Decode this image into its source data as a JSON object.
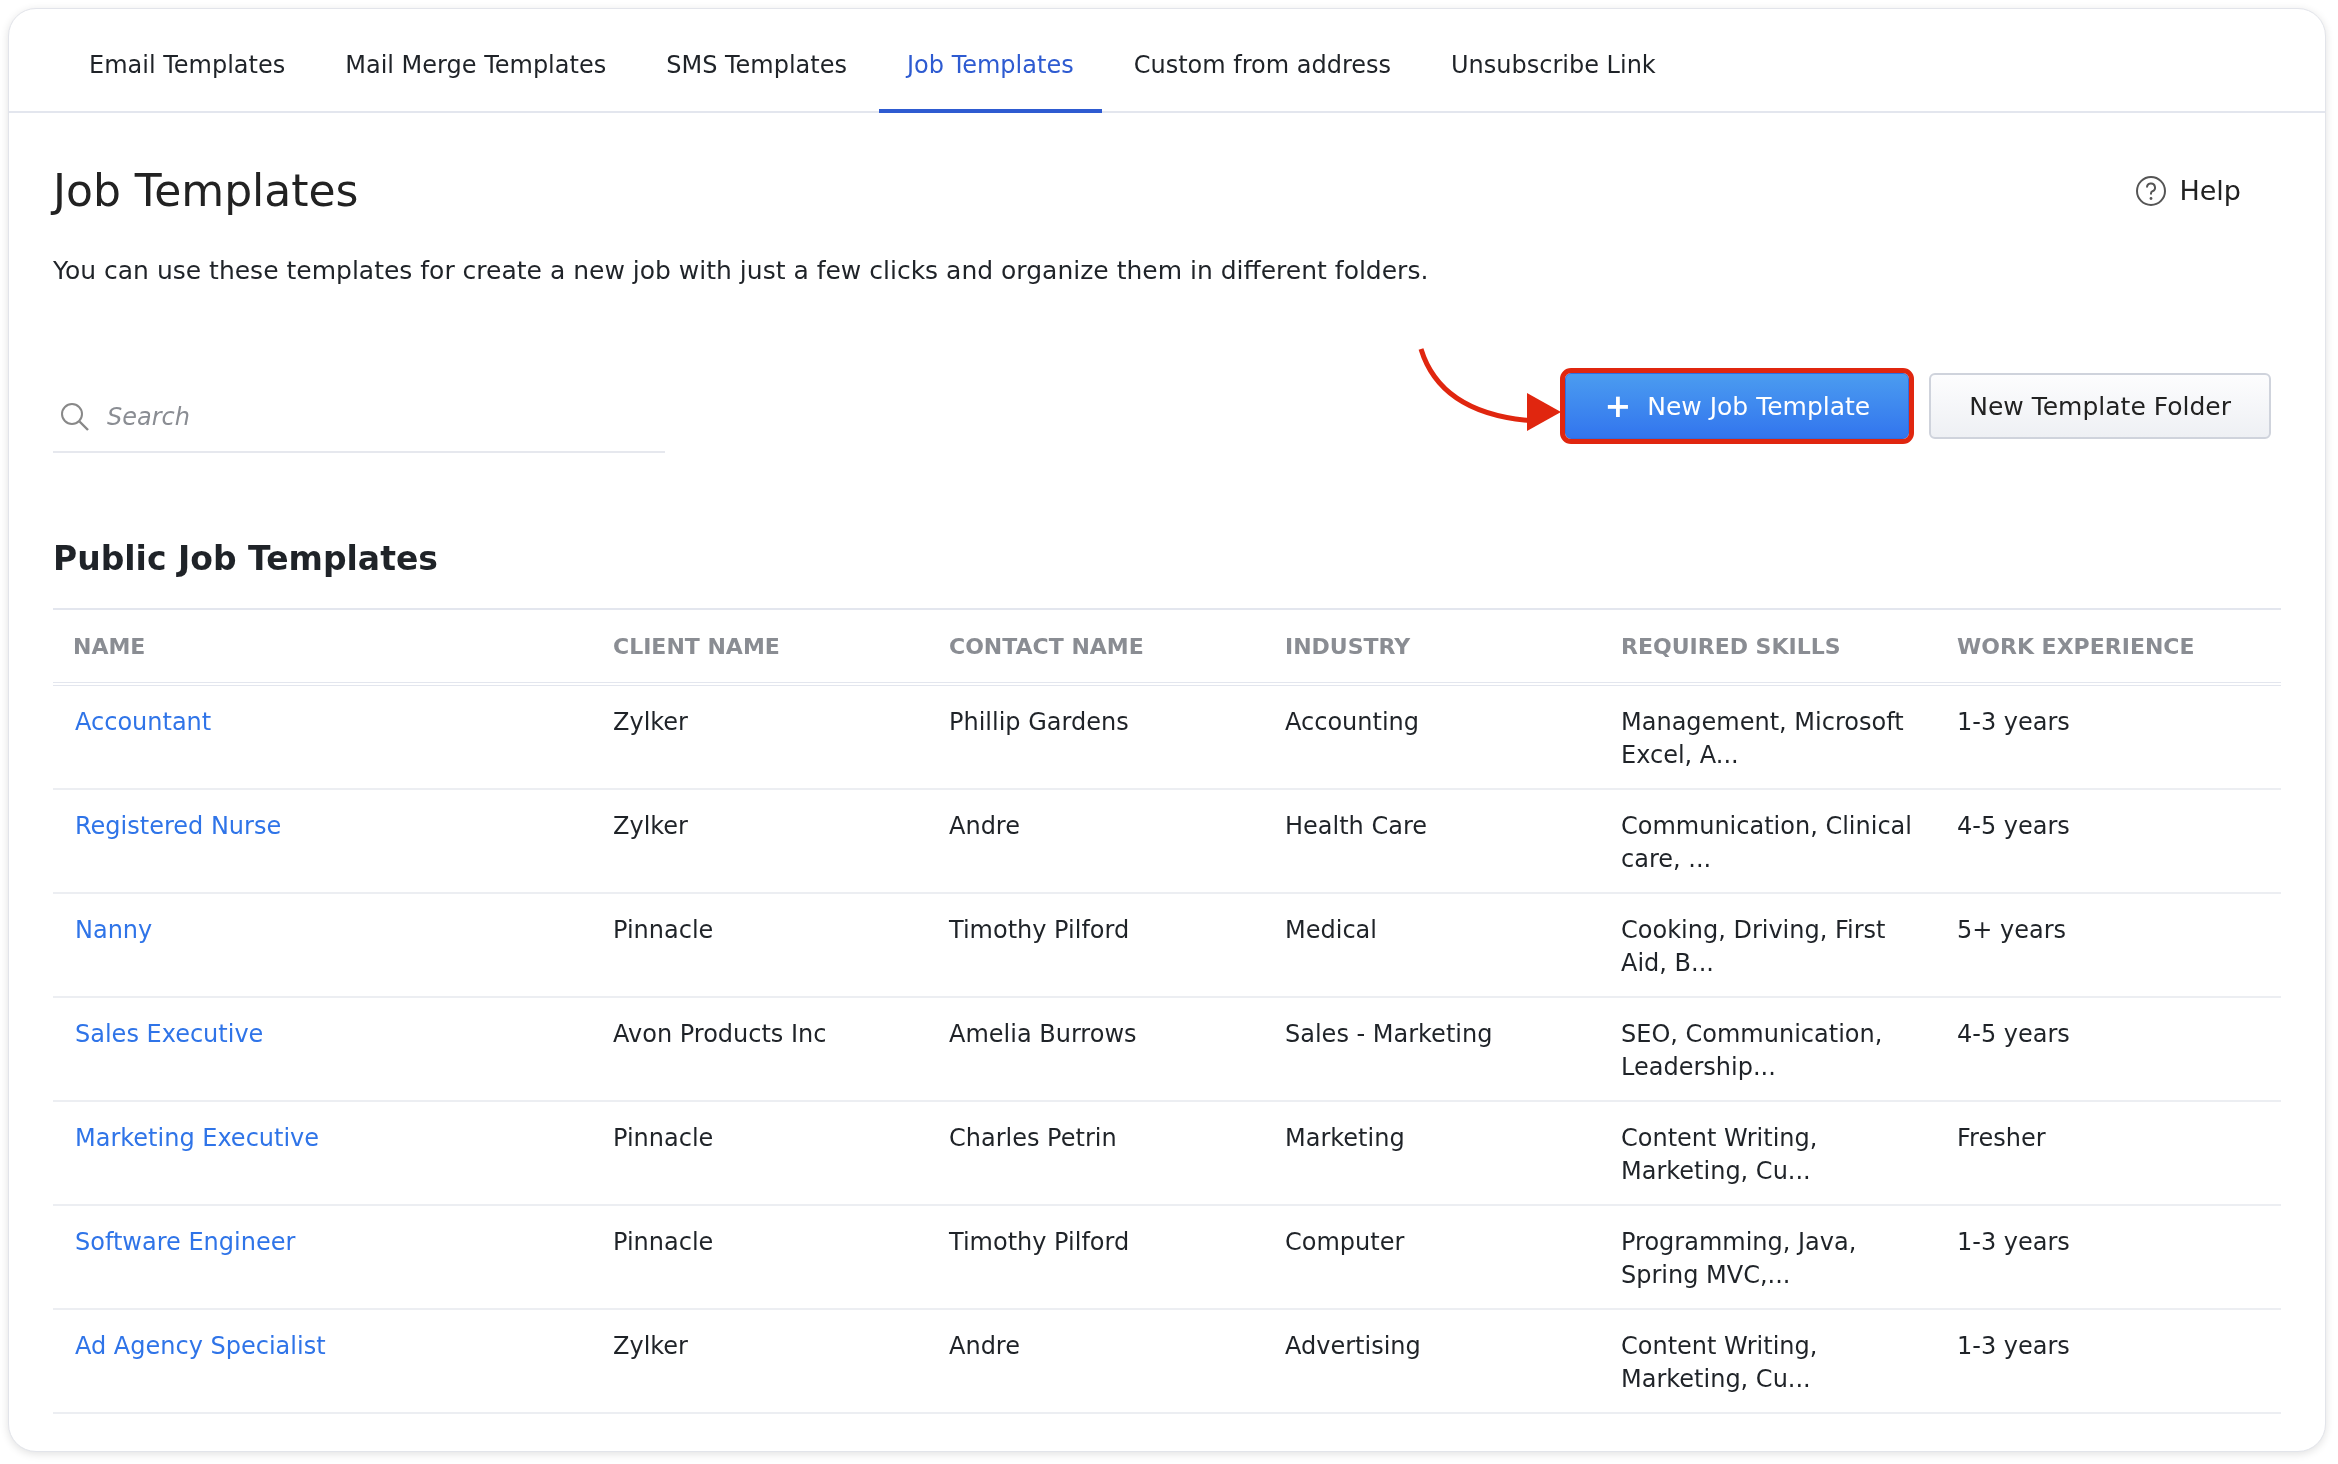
{
  "tabs": [
    {
      "label": "Email Templates",
      "selected": false
    },
    {
      "label": "Mail Merge Templates",
      "selected": false
    },
    {
      "label": "SMS Templates",
      "selected": false
    },
    {
      "label": "Job Templates",
      "selected": true
    },
    {
      "label": "Custom from address",
      "selected": false
    },
    {
      "label": "Unsubscribe Link",
      "selected": false
    }
  ],
  "page": {
    "title": "Job Templates",
    "help": "Help",
    "description": "You can use these templates for create a new job with just a few clicks and organize them in different folders."
  },
  "search": {
    "placeholder": "Search"
  },
  "buttons": [
    {
      "kind": "primary",
      "icon": "+",
      "label": "New Job Template",
      "highlighted": true
    },
    {
      "kind": "secondary",
      "label": "New Template Folder",
      "highlighted": false
    }
  ],
  "section_title": "Public Job Templates",
  "table": {
    "columns": [
      "NAME",
      "CLIENT NAME",
      "CONTACT NAME",
      "INDUSTRY",
      "REQUIRED SKILLS",
      "WORK EXPERIENCE"
    ],
    "rows": [
      [
        "Accountant",
        "Zylker",
        "Phillip Gardens",
        "Accounting",
        "Management, Microsoft Excel, A...",
        "1-3 years"
      ],
      [
        "Registered Nurse",
        "Zylker",
        "Andre",
        "Health Care",
        "Communication, Clinical care, ...",
        "4-5 years"
      ],
      [
        "Nanny",
        "Pinnacle",
        "Timothy Pilford",
        "Medical",
        "Cooking, Driving, First Aid, B...",
        "5+ years"
      ],
      [
        "Sales Executive",
        "Avon Products Inc",
        "Amelia Burrows",
        "Sales - Marketing",
        "SEO, Communication, Leadership...",
        "4-5 years"
      ],
      [
        "Marketing Executive",
        "Pinnacle",
        "Charles Petrin",
        "Marketing",
        "Content Writing, Marketing, Cu...",
        "Fresher"
      ],
      [
        "Software Engineer",
        "Pinnacle",
        "Timothy Pilford",
        "Computer",
        "Programming, Java, Spring MVC,...",
        "1-3 years"
      ],
      [
        "Ad Agency Specialist",
        "Zylker",
        "Andre",
        "Advertising",
        "Content Writing, Marketing, Cu...",
        "1-3 years"
      ]
    ]
  }
}
